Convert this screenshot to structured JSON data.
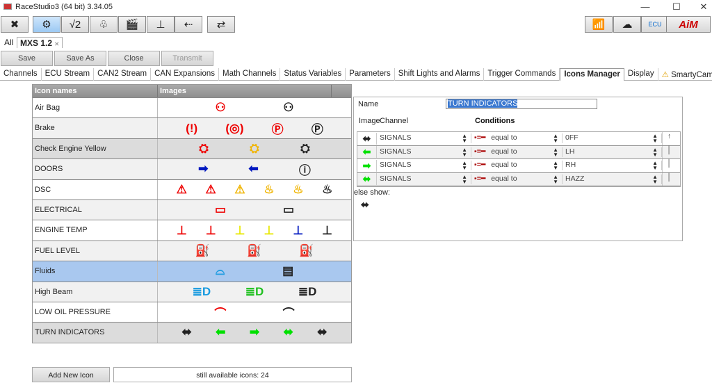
{
  "window": {
    "title": "RaceStudio3 (64 bit) 3.34.05"
  },
  "toolbar": [
    {
      "name": "wrench-icon",
      "glyph": "✖"
    },
    {
      "name": "gears-icon",
      "glyph": "⚙",
      "active": true
    },
    {
      "name": "math-icon",
      "glyph": "√2"
    },
    {
      "name": "track-icon",
      "glyph": "♧"
    },
    {
      "name": "clapper-icon",
      "glyph": "🎬"
    },
    {
      "name": "temperature-icon",
      "glyph": "⊥"
    },
    {
      "name": "add-device-icon",
      "glyph": "⇠"
    },
    {
      "name": "transfer-icon",
      "glyph": "⇄"
    }
  ],
  "right_toolbar": [
    {
      "name": "wifi-icon",
      "glyph": "📶"
    },
    {
      "name": "cloud-error-icon",
      "glyph": "☁"
    },
    {
      "name": "ecu-icon",
      "glyph": "ECU"
    },
    {
      "name": "aim-logo",
      "glyph": "AiM"
    }
  ],
  "device_tabs": {
    "all": "All",
    "current": "MXS 1.2"
  },
  "actions": {
    "save": "Save",
    "save_as": "Save As",
    "close": "Close",
    "transmit": "Transmit"
  },
  "tabs": [
    "Channels",
    "ECU Stream",
    "CAN2 Stream",
    "CAN Expansions",
    "Math Channels",
    "Status Variables",
    "Parameters",
    "Shift Lights and Alarms",
    "Trigger Commands",
    "Icons Manager",
    "Display",
    "SmartyCam"
  ],
  "selected_tab": "Icons Manager",
  "table": {
    "headers": [
      "Icon names",
      "Images"
    ],
    "rows": [
      {
        "name": "Air Bag",
        "icons": [
          [
            "airbag",
            "#e00"
          ],
          [
            "airbag",
            "#222"
          ]
        ]
      },
      {
        "name": "Brake",
        "icons": [
          [
            "brake",
            "#e00"
          ],
          [
            "abs",
            "#e00"
          ],
          [
            "park",
            "#e00"
          ],
          [
            "park",
            "#222"
          ]
        ]
      },
      {
        "name": "Check Engine Yellow",
        "icons": [
          [
            "engine",
            "#e00"
          ],
          [
            "engine",
            "#f0b400"
          ],
          [
            "engine",
            "#222"
          ]
        ],
        "bg": "#dcdcdc"
      },
      {
        "name": "DOORS",
        "icons": [
          [
            "right",
            "#0018c0"
          ],
          [
            "left",
            "#0018c0"
          ],
          [
            "info",
            "#222"
          ]
        ]
      },
      {
        "name": "DSC",
        "icons": [
          [
            "warn",
            "#e00"
          ],
          [
            "warn",
            "#e00"
          ],
          [
            "warn",
            "#f0b400"
          ],
          [
            "skid",
            "#f0b400"
          ],
          [
            "skid",
            "#f0b400"
          ],
          [
            "skid",
            "#222"
          ]
        ]
      },
      {
        "name": "ELECTRICAL",
        "icons": [
          [
            "battery",
            "#e00"
          ],
          [
            "battery",
            "#222"
          ]
        ]
      },
      {
        "name": "ENGINE TEMP",
        "icons": [
          [
            "temp",
            "#e00"
          ],
          [
            "temp",
            "#e00"
          ],
          [
            "temp",
            "#e8e800"
          ],
          [
            "temp",
            "#e8e800"
          ],
          [
            "temp",
            "#0018c0"
          ],
          [
            "temp",
            "#222"
          ]
        ]
      },
      {
        "name": "FUEL LEVEL",
        "icons": [
          [
            "fuel",
            "#e00"
          ],
          [
            "fuel",
            "#f0b400"
          ],
          [
            "fuel",
            "#222"
          ]
        ]
      },
      {
        "name": "Fluids",
        "icons": [
          [
            "washer",
            "#1a9be0"
          ],
          [
            "coolant",
            "#222"
          ]
        ],
        "bg": "#a9c8ef"
      },
      {
        "name": "High Beam",
        "icons": [
          [
            "beam",
            "#1a9be0"
          ],
          [
            "beam",
            "#20c020"
          ],
          [
            "beam",
            "#222"
          ]
        ]
      },
      {
        "name": "LOW OIL PRESSURE",
        "icons": [
          [
            "oil",
            "#e00"
          ],
          [
            "oil",
            "#222"
          ]
        ]
      },
      {
        "name": "TURN INDICATORS",
        "icons": [
          [
            "both",
            "#222"
          ],
          [
            "left",
            "#00e000"
          ],
          [
            "right",
            "#00e000"
          ],
          [
            "both",
            "#00e000"
          ],
          [
            "both",
            "#222"
          ]
        ],
        "bg": "#dcdcdc"
      }
    ]
  },
  "panel": {
    "name_label": "Name",
    "name_value": "TURN INDICATORS",
    "image_label": "Image",
    "channel_label": "Channel",
    "conditions_label": "Conditions",
    "conditions": [
      {
        "icon": [
          "both",
          "#222"
        ],
        "channel": "SIGNALS",
        "op": "equal to",
        "value": "0FF"
      },
      {
        "icon": [
          "left",
          "#00e000"
        ],
        "channel": "SIGNALS",
        "op": "equal to",
        "value": "LH"
      },
      {
        "icon": [
          "right",
          "#00e000"
        ],
        "channel": "SIGNALS",
        "op": "equal to",
        "value": "RH"
      },
      {
        "icon": [
          "both",
          "#00e000"
        ],
        "channel": "SIGNALS",
        "op": "equal to",
        "value": "HAZZ"
      }
    ],
    "else_label": "else show:",
    "else_icon": [
      "both",
      "#222"
    ]
  },
  "footer": {
    "add_label": "Add New Icon",
    "available": "still available icons: 24"
  }
}
